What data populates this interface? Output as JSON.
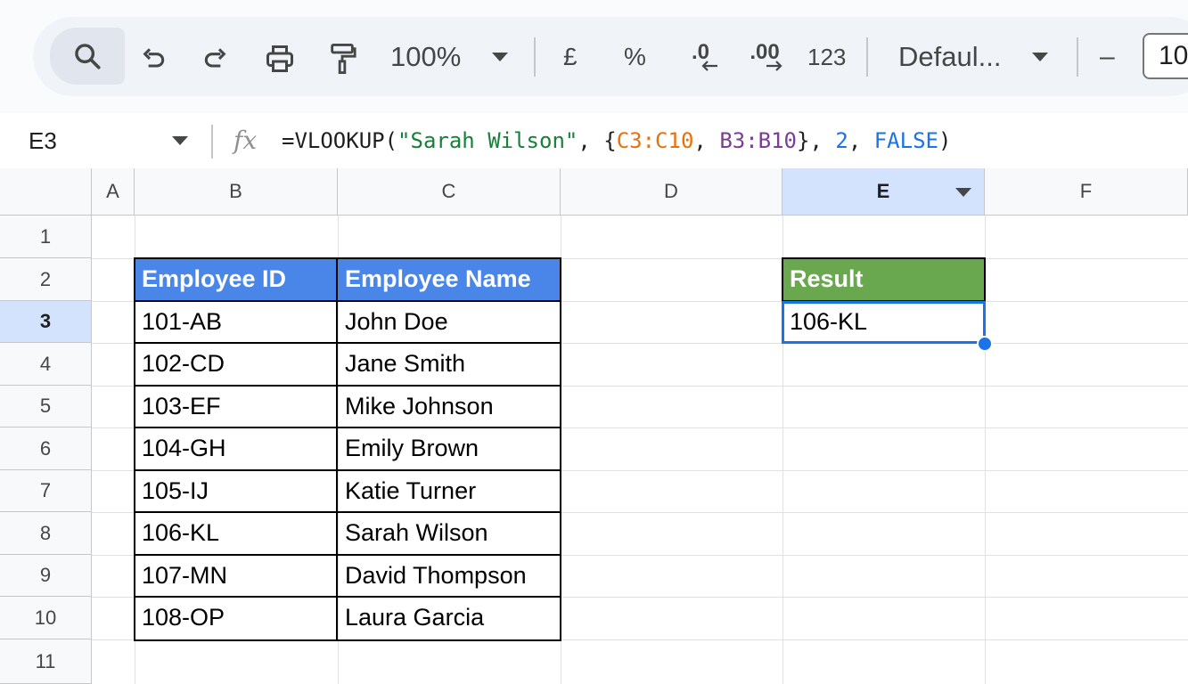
{
  "toolbar": {
    "zoom": "100%",
    "currency": "£",
    "percent": "%",
    "dec_decrease": ".0",
    "dec_increase": ".00",
    "number_format": "123",
    "font": "Defaul...",
    "font_size": "10",
    "minus": "–"
  },
  "formula_bar": {
    "cell_ref": "E3",
    "fx": "fx",
    "f_prefix": "=VLOOKUP(",
    "f_string": "\"Sarah Wilson\"",
    "f_sep1": ", {",
    "f_range1": "C3:C10",
    "f_sep2": ", ",
    "f_range2": "B3:B10",
    "f_sep3": "}, ",
    "f_index": "2",
    "f_sep4": ", ",
    "f_bool": "FALSE",
    "f_close": ")"
  },
  "columns": [
    "A",
    "B",
    "C",
    "D",
    "E",
    "F"
  ],
  "rows": [
    "1",
    "2",
    "3",
    "4",
    "5",
    "6",
    "7",
    "8",
    "9",
    "10",
    "11"
  ],
  "table": {
    "headers": [
      "Employee ID",
      "Employee Name"
    ],
    "rows": [
      [
        "101-AB",
        "John Doe"
      ],
      [
        "102-CD",
        "Jane Smith"
      ],
      [
        "103-EF",
        "Mike Johnson"
      ],
      [
        "104-GH",
        "Emily Brown"
      ],
      [
        "105-IJ",
        "Katie Turner"
      ],
      [
        "106-KL",
        "Sarah Wilson"
      ],
      [
        "107-MN",
        "David Thompson"
      ],
      [
        "108-OP",
        "Laura Garcia"
      ]
    ]
  },
  "result": {
    "header": "Result",
    "value": "106-KL"
  },
  "selected_cell": "E3",
  "colors": {
    "header_blue": "#4a86e8",
    "header_green": "#6aa84f",
    "selection": "#1a73e8"
  }
}
